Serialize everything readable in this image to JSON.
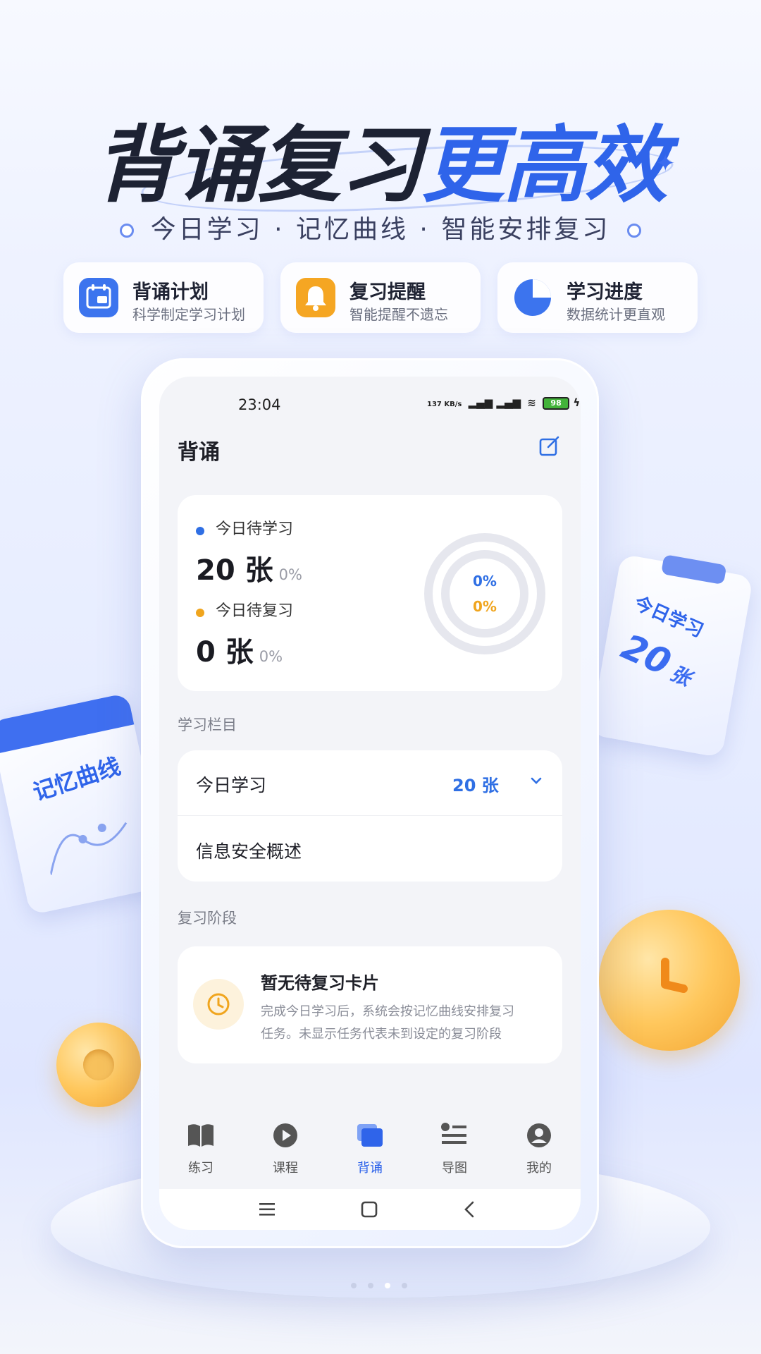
{
  "hero": {
    "title_dark": "背诵复习",
    "title_blue": "更高效",
    "subtitle": "今日学习 · 记忆曲线 · 智能安排复习"
  },
  "features": [
    {
      "title": "背诵计划",
      "desc": "科学制定学习计划",
      "icon": "calendar-icon",
      "color": "#3c74ee"
    },
    {
      "title": "复习提醒",
      "desc": "智能提醒不遗忘",
      "icon": "bell-icon",
      "color": "#f5a623"
    },
    {
      "title": "学习进度",
      "desc": "数据统计更直观",
      "icon": "pie-chart-icon",
      "color": "#3c74ee"
    }
  ],
  "status_bar": {
    "time": "23:04",
    "net_speed": "137 KB/s",
    "signal": "HD",
    "battery": "98"
  },
  "app": {
    "title": "背诵"
  },
  "stats": {
    "today_learn_label": "今日待学习",
    "today_learn_value": "20 张",
    "today_learn_pct": "0%",
    "today_review_label": "今日待复习",
    "today_review_value": "0 张",
    "today_review_pct": "0%",
    "ring_learn_pct": "0%",
    "ring_review_pct": "0%",
    "learn_color": "#2f6fe4",
    "review_color": "#f0a51e"
  },
  "study_section": {
    "label": "学习栏目",
    "row_title": "今日学习",
    "row_value": "20 张",
    "course": "信息安全概述"
  },
  "review_section": {
    "label": "复习阶段",
    "empty_title": "暂无待复习卡片",
    "empty_desc_1": "完成今日学习后，系统会按记忆曲线安排复习",
    "empty_desc_2": "任务。未显示任务代表未到设定的复习阶段"
  },
  "tabs": [
    {
      "label": "练习",
      "icon": "book-icon",
      "active": false
    },
    {
      "label": "课程",
      "icon": "play-icon",
      "active": false
    },
    {
      "label": "背诵",
      "icon": "cards-icon",
      "active": true
    },
    {
      "label": "导图",
      "icon": "mindmap-icon",
      "active": false
    },
    {
      "label": "我的",
      "icon": "user-icon",
      "active": false
    }
  ],
  "deco": {
    "left_calendar": "记忆曲线",
    "right_card_title": "今日学习",
    "right_card_num": "20",
    "right_card_unit": "张"
  }
}
